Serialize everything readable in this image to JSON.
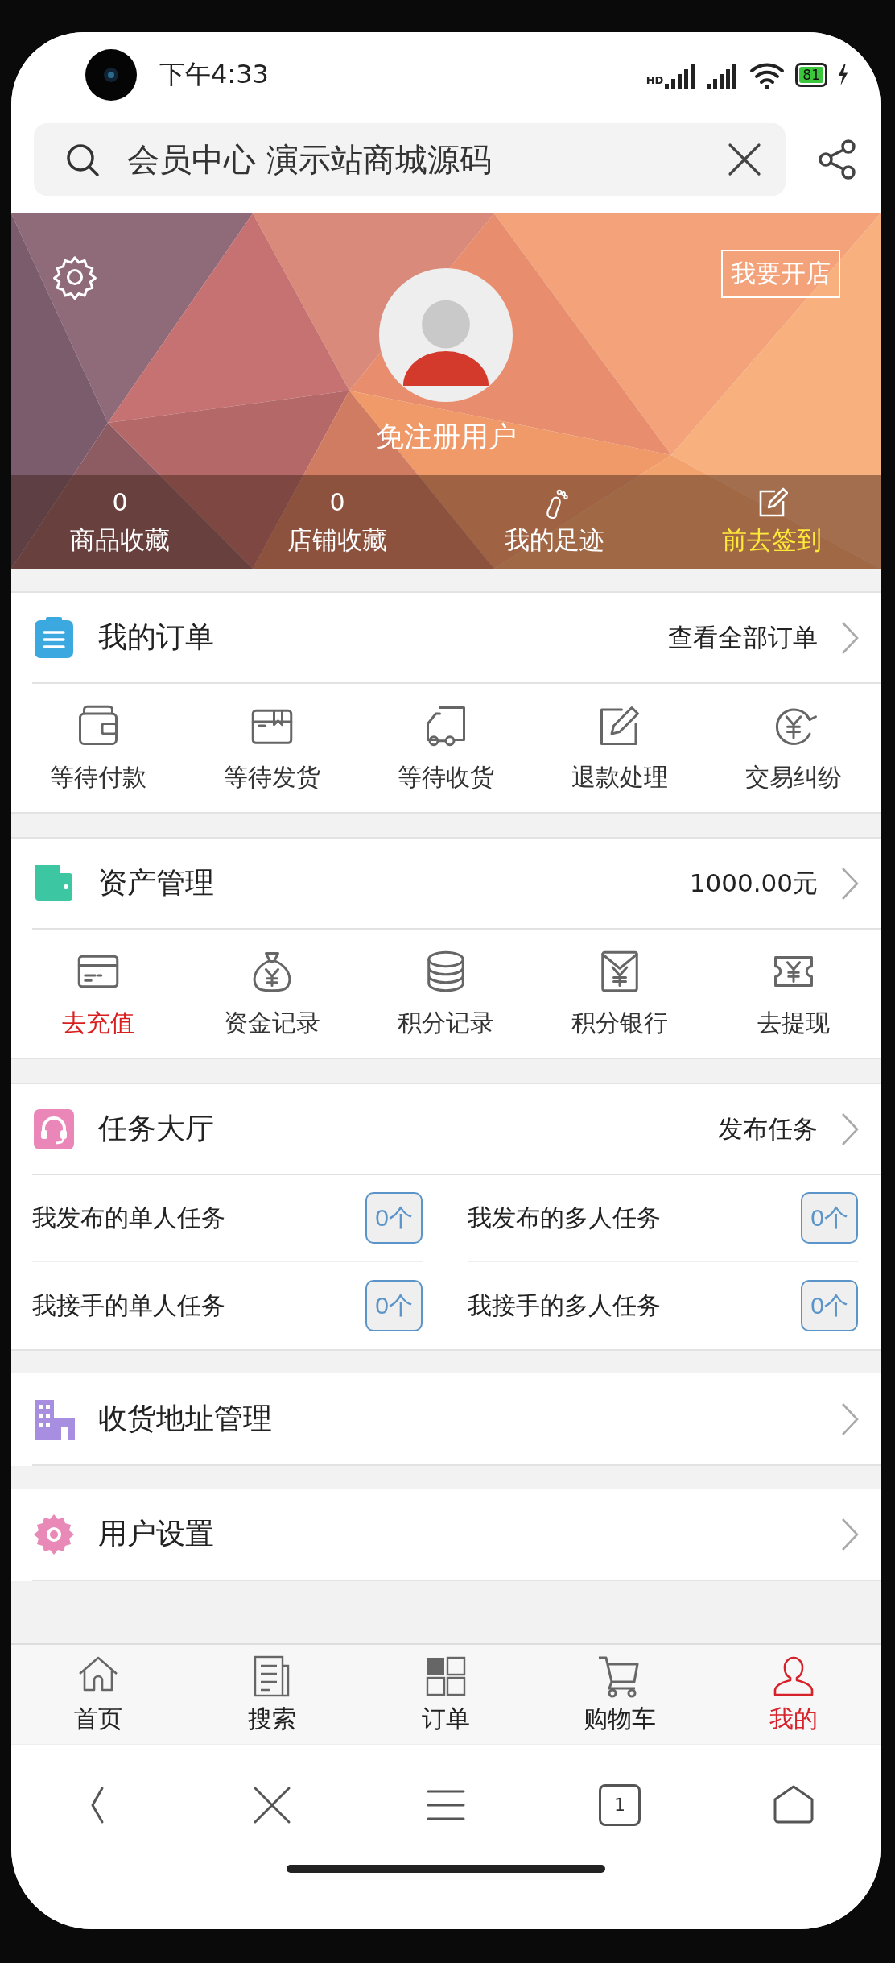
{
  "status_bar": {
    "time": "下午4:33",
    "network": "HD",
    "battery": "81"
  },
  "search": {
    "value": "会员中心 演示站商城源码"
  },
  "profile": {
    "username": "免注册用户",
    "open_shop_button": "我要开店",
    "stats": [
      {
        "kind": "count",
        "value": "0",
        "label": "商品收藏"
      },
      {
        "kind": "count",
        "value": "0",
        "label": "店铺收藏"
      },
      {
        "kind": "footprint",
        "label": "我的足迹"
      },
      {
        "kind": "checkin",
        "label": "前去签到"
      }
    ]
  },
  "orders": {
    "title": "我的订单",
    "link": "查看全部订单",
    "items": [
      {
        "label": "等待付款"
      },
      {
        "label": "等待发货"
      },
      {
        "label": "等待收货"
      },
      {
        "label": "退款处理"
      },
      {
        "label": "交易纠纷"
      }
    ]
  },
  "assets": {
    "title": "资产管理",
    "link": "1000.00元",
    "items": [
      {
        "label": "去充值",
        "highlighted": true
      },
      {
        "label": "资金记录",
        "highlighted": false
      },
      {
        "label": "积分记录",
        "highlighted": false
      },
      {
        "label": "积分银行",
        "highlighted": false
      },
      {
        "label": "去提现",
        "highlighted": false
      }
    ]
  },
  "tasks": {
    "title": "任务大厅",
    "link": "发布任务",
    "rows": [
      {
        "label": "我发布的单人任务",
        "count": "0个"
      },
      {
        "label": "我发布的多人任务",
        "count": "0个"
      },
      {
        "label": "我接手的单人任务",
        "count": "0个"
      },
      {
        "label": "我接手的多人任务",
        "count": "0个"
      }
    ]
  },
  "links": [
    {
      "title": "收货地址管理"
    },
    {
      "title": "用户设置"
    }
  ],
  "tab_bar": [
    {
      "label": "首页",
      "selected": false
    },
    {
      "label": "搜索",
      "selected": false
    },
    {
      "label": "订单",
      "selected": false
    },
    {
      "label": "购物车",
      "selected": false
    },
    {
      "label": "我的",
      "selected": true
    }
  ],
  "browser_nav": {
    "tab_count": "1"
  }
}
